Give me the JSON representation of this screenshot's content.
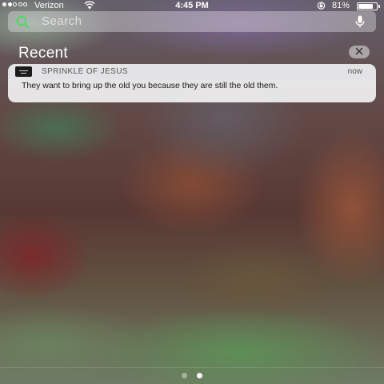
{
  "status_bar": {
    "carrier": "Verizon",
    "signal_bars_filled": 2,
    "signal_bars_total": 5,
    "time": "4:45 PM",
    "battery_percent": "81%",
    "battery_level": 0.81,
    "icons": [
      "wifi-icon",
      "orientation-lock-icon",
      "battery-icon"
    ]
  },
  "search": {
    "placeholder": "Search",
    "icons": [
      "search-icon",
      "microphone-icon"
    ],
    "accent_color": "#4cd964"
  },
  "recent": {
    "title": "Recent",
    "clear_icon": "close-icon"
  },
  "notification": {
    "app_name": "SPRINKLE OF JESUS",
    "time": "now",
    "message": "They want to bring up the old you because they are still the old them."
  },
  "page_indicator": {
    "total": 2,
    "active_index": 1
  }
}
